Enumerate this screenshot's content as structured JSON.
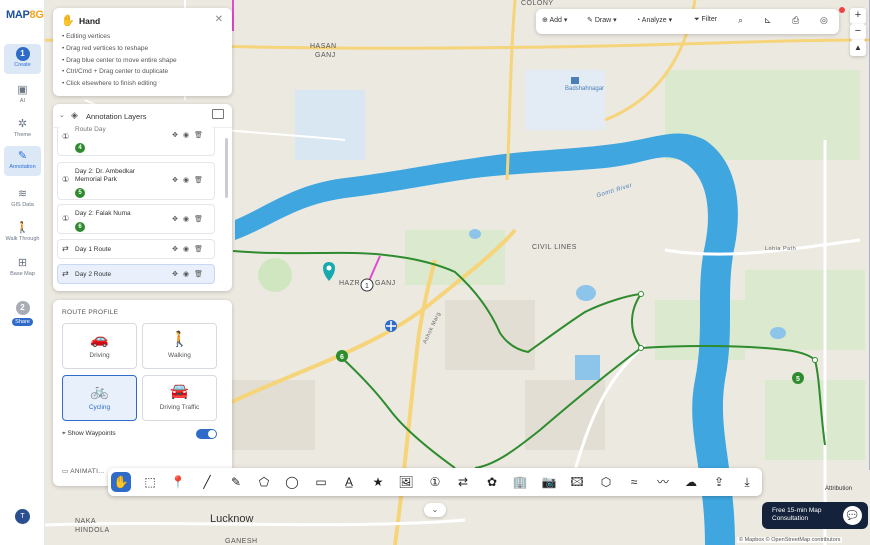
{
  "app": {
    "logo_text": "MAP",
    "logo_accent": "8G"
  },
  "rail": {
    "items": [
      {
        "badge": "1",
        "label": "Create",
        "icon": "create-step-icon",
        "active": true
      },
      {
        "label": "AI",
        "icon": "ai-icon"
      },
      {
        "label": "Theme",
        "icon": "theme-icon"
      },
      {
        "label": "Annotation",
        "icon": "annotation-icon",
        "active": true
      },
      {
        "label": "GIS Data",
        "icon": "layers-icon"
      },
      {
        "label": "Walk Through",
        "icon": "walk-icon"
      },
      {
        "label": "Base Map",
        "icon": "basemap-icon"
      },
      {
        "badge": "2",
        "label": "Share",
        "icon": "share-step-icon"
      }
    ],
    "avatar": "T"
  },
  "hand_panel": {
    "title": "Hand",
    "tips": [
      "• Editing vertices",
      "• Drag red vertices to reshape",
      "• Drag blue center to move entire shape",
      "• Ctrl/Cmd + Drag center to duplicate",
      "• Click elsewhere to finish editing"
    ]
  },
  "layers": {
    "title": "Annotation Layers",
    "rows": [
      {
        "name": "Route Day",
        "num": "4",
        "type": "marker"
      },
      {
        "name": "Day 2: Dr. Ambedkar Memorial Park",
        "num": "5",
        "type": "marker"
      },
      {
        "name": "Day 2: Falak Numa",
        "num": "6",
        "type": "marker"
      },
      {
        "name": "Day 1 Route",
        "type": "route"
      },
      {
        "name": "Day 2 Route",
        "type": "route",
        "selected": true
      }
    ]
  },
  "route_profile": {
    "title": "ROUTE PROFILE",
    "modes": [
      {
        "label": "Driving",
        "icon": "car-icon"
      },
      {
        "label": "Walking",
        "icon": "walking-icon"
      },
      {
        "label": "Cycling",
        "icon": "bicycle-icon",
        "active": true
      },
      {
        "label": "Driving Traffic",
        "icon": "car-traffic-icon"
      }
    ],
    "waypoints_label": "Show Waypoints",
    "waypoints_on": true,
    "animation_label": "ANIMATI..."
  },
  "topbar": {
    "add": "Add",
    "draw": "Draw",
    "analyze": "Analyze",
    "filter": "Filter"
  },
  "map": {
    "labels": {
      "hasanganj": "HASAN",
      "hasanganj2": "GANJ",
      "badshahnagar": "Badshahnagar",
      "civil_lines": "CIVIL LINES",
      "hazratganj": "HAZR",
      "hazratganj2": "GANJ",
      "lucknow": "Lucknow",
      "naka": "NAKA",
      "hindola": "HINDOLA",
      "gomti": "Gomti River",
      "lohia": "Lohia Path",
      "ashok": "Ashok Marg",
      "colony": "COLONY",
      "ganesh": "GANESH"
    },
    "markers": [
      "5",
      "6",
      "1"
    ],
    "colors": {
      "route": "#2e8b2e",
      "river": "#3fa6e0",
      "road": "#f6d47a"
    }
  },
  "consult": {
    "text": "Free 15-min Map Consultation"
  },
  "attribution": {
    "short": "Attribution",
    "full": "© Mapbox © OpenStreetMap contributors"
  }
}
